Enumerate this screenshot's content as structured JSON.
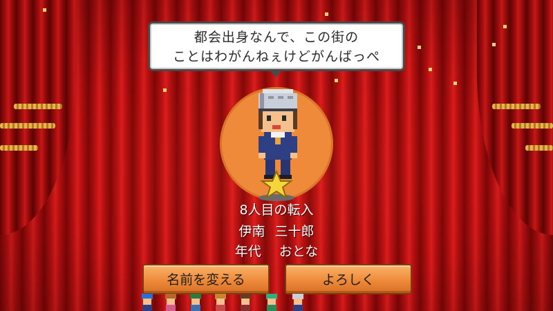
{
  "speech": {
    "line1": "都会出身なんで、この街の",
    "line2": "ことはわがんねぇけどがんばっぺ"
  },
  "resident": {
    "arrival": "8人目の転入",
    "family_name": "伊南",
    "given_name": "三十郎",
    "age_label": "年代",
    "age_value": "おとな"
  },
  "buttons": {
    "rename": "名前を変える",
    "confirm": "よろしく"
  },
  "colors": {
    "curtain": "#b30f10",
    "spotlight": "#ee8a3a",
    "button": "#ee8a3a",
    "fringe": "#e8b44a"
  },
  "icons": [
    "star-icon",
    "character-sprite",
    "resident-sprite"
  ]
}
